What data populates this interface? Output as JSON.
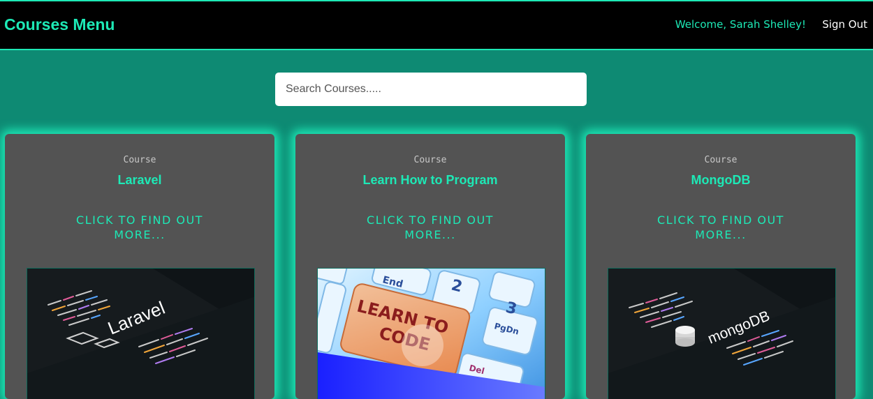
{
  "nav": {
    "brand": "Courses Menu",
    "welcome": "Welcome, Sarah Shelley!",
    "signout": "Sign Out"
  },
  "search": {
    "placeholder": "Search Courses.....",
    "value": ""
  },
  "courses": [
    {
      "kicker": "Course",
      "title": "Laravel",
      "link": "CLICK TO FIND OUT MORE...",
      "image_text": "Laravel"
    },
    {
      "kicker": "Course",
      "title": "Learn How to Program",
      "link": "CLICK TO FIND OUT MORE...",
      "image_text": "LEARN TO CODE"
    },
    {
      "kicker": "Course",
      "title": "MongoDB",
      "link": "CLICK TO FIND OUT MORE...",
      "image_text": "mongoDB"
    }
  ],
  "colors": {
    "accent": "#1de9b6",
    "page_bg": "#0e8a73",
    "card_bg": "#535353",
    "nav_bg": "#000000"
  }
}
